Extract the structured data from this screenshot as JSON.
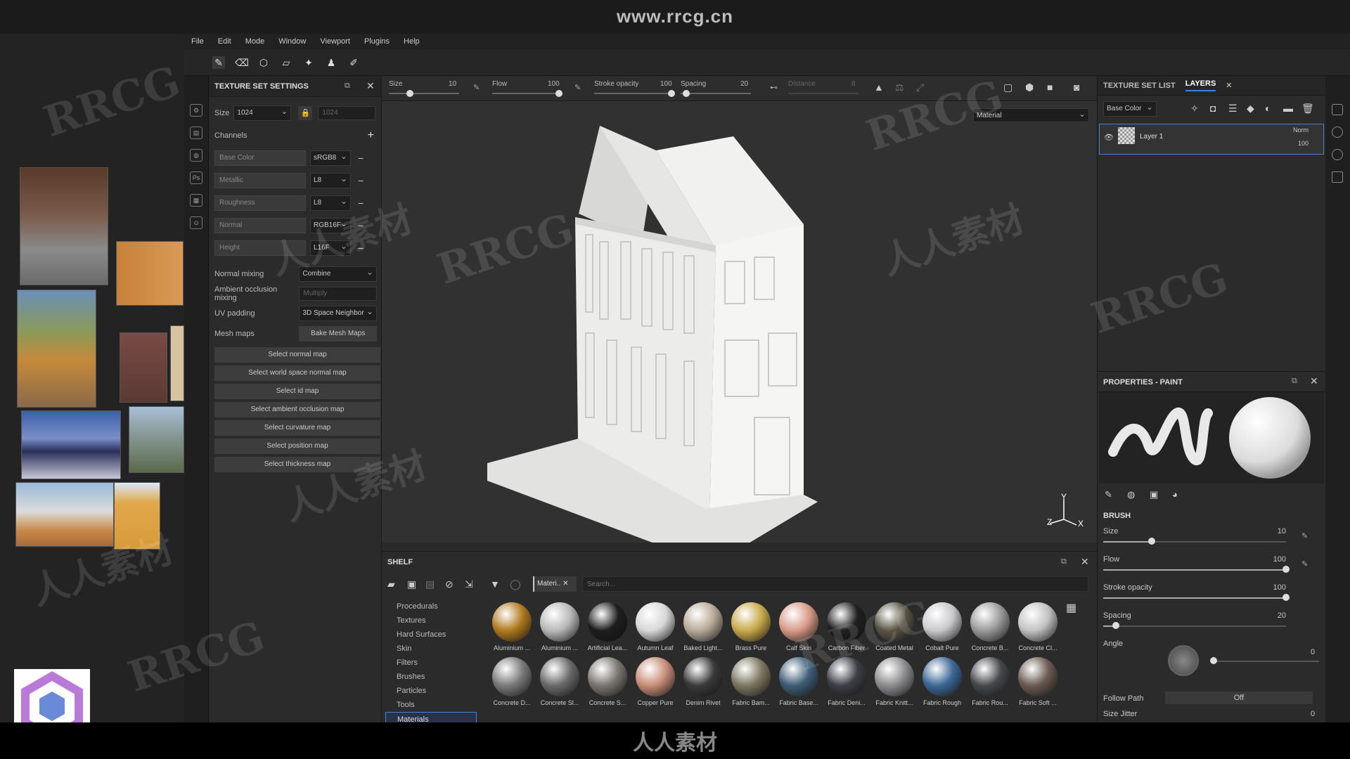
{
  "watermark": {
    "site": "www.rrcg.cn",
    "bottom_brand": "人人素材",
    "diag": "RRCG",
    "diag_cn": "人人素材"
  },
  "menu": [
    "File",
    "Edit",
    "Mode",
    "Window",
    "Viewport",
    "Plugins",
    "Help"
  ],
  "tss": {
    "title": "TEXTURE SET SETTINGS",
    "size_label": "Size",
    "size_value": "1024",
    "size_value2": "1024",
    "channels_label": "Channels",
    "channels": [
      {
        "name": "Base Color",
        "format": "sRGB8"
      },
      {
        "name": "Metallic",
        "format": "L8"
      },
      {
        "name": "Roughness",
        "format": "L8"
      },
      {
        "name": "Normal",
        "format": "RGB16F"
      },
      {
        "name": "Height",
        "format": "L16F"
      }
    ],
    "normal_mixing_label": "Normal mixing",
    "normal_mixing_value": "Combine",
    "ao_mixing_label": "Ambient occlusion mixing",
    "ao_mixing_value": "Multiply",
    "uv_padding_label": "UV padding",
    "uv_padding_value": "3D Space Neighbor",
    "mesh_maps_label": "Mesh maps",
    "bake_button": "Bake Mesh Maps",
    "map_buttons": [
      "Select normal map",
      "Select world space normal map",
      "Select id map",
      "Select ambient occlusion map",
      "Select curvature map",
      "Select position map",
      "Select thickness map"
    ]
  },
  "brushbar": {
    "size_label": "Size",
    "size_value": "10",
    "flow_label": "Flow",
    "flow_value": "100",
    "opacity_label": "Stroke opacity",
    "opacity_value": "100",
    "spacing_label": "Spacing",
    "spacing_value": "20",
    "distance_label": "Distance",
    "distance_value": "8"
  },
  "viewport": {
    "mode": "Material",
    "axes": [
      "Y",
      "Z",
      "X"
    ]
  },
  "shelf": {
    "title": "SHELF",
    "filter_tag": "Materi..",
    "search_placeholder": "Search...",
    "categories": [
      "Procedurals",
      "Textures",
      "Hard Surfaces",
      "Skin",
      "Filters",
      "Brushes",
      "Particles",
      "Tools",
      "Materials"
    ],
    "active_category": "Materials",
    "materials_row1": [
      {
        "label": "Aluminium ...",
        "color": "#b07a1e"
      },
      {
        "label": "Aluminium ...",
        "color": "#b9b9b9"
      },
      {
        "label": "Artificial Lea...",
        "color": "#1d1d1d"
      },
      {
        "label": "Autumn Leaf",
        "color": "#d7d7d7"
      },
      {
        "label": "Baked Light...",
        "color": "#b8aa98"
      },
      {
        "label": "Brass Pure",
        "color": "#c8a94a"
      },
      {
        "label": "Calf Skin",
        "color": "#d89a86"
      },
      {
        "label": "Carbon Fiber",
        "color": "#202020"
      },
      {
        "label": "Coated Metal",
        "color": "#5a5444"
      },
      {
        "label": "Cobalt Pure",
        "color": "#c8c8cc"
      },
      {
        "label": "Concrete B...",
        "color": "#9a9a9a"
      },
      {
        "label": "Concrete Cl...",
        "color": "#c2c2c2"
      }
    ],
    "materials_row2": [
      {
        "label": "Concrete D...",
        "color": "#7a7a7a"
      },
      {
        "label": "Concrete Sl...",
        "color": "#6a6a6a"
      },
      {
        "label": "Concrete S...",
        "color": "#7b7670"
      },
      {
        "label": "Copper Pure",
        "color": "#c88d77"
      },
      {
        "label": "Denim Rivet",
        "color": "#3a3a3a"
      },
      {
        "label": "Fabric Bam...",
        "color": "#7d7761"
      },
      {
        "label": "Fabric Base...",
        "color": "#3e5d76"
      },
      {
        "label": "Fabric Deni...",
        "color": "#3c3f47"
      },
      {
        "label": "Fabric Knitt...",
        "color": "#8c8c8e"
      },
      {
        "label": "Fabric Rough",
        "color": "#3c6896"
      },
      {
        "label": "Fabric Rou...",
        "color": "#47484b"
      },
      {
        "label": "Fabric Soft ...",
        "color": "#6a5a52"
      }
    ]
  },
  "right": {
    "tab1": "TEXTURE SET LIST",
    "tab2": "LAYERS",
    "channel_select": "Base Color",
    "layer_name": "Layer 1",
    "blend_mode": "Norm",
    "layer_opacity": "100",
    "props_title": "PROPERTIES - PAINT",
    "brush_section": "BRUSH",
    "sliders": [
      {
        "label": "Size",
        "value": "10",
        "fraction": 0.25
      },
      {
        "label": "Flow",
        "value": "100",
        "fraction": 1.0
      },
      {
        "label": "Stroke opacity",
        "value": "100",
        "fraction": 1.0
      },
      {
        "label": "Spacing",
        "value": "20",
        "fraction": 0.05
      }
    ],
    "angle_label": "Angle",
    "angle_value": "0",
    "follow_path_label": "Follow Path",
    "follow_path_value": "Off",
    "size_jitter_label": "Size Jitter",
    "size_jitter_value": "0"
  }
}
